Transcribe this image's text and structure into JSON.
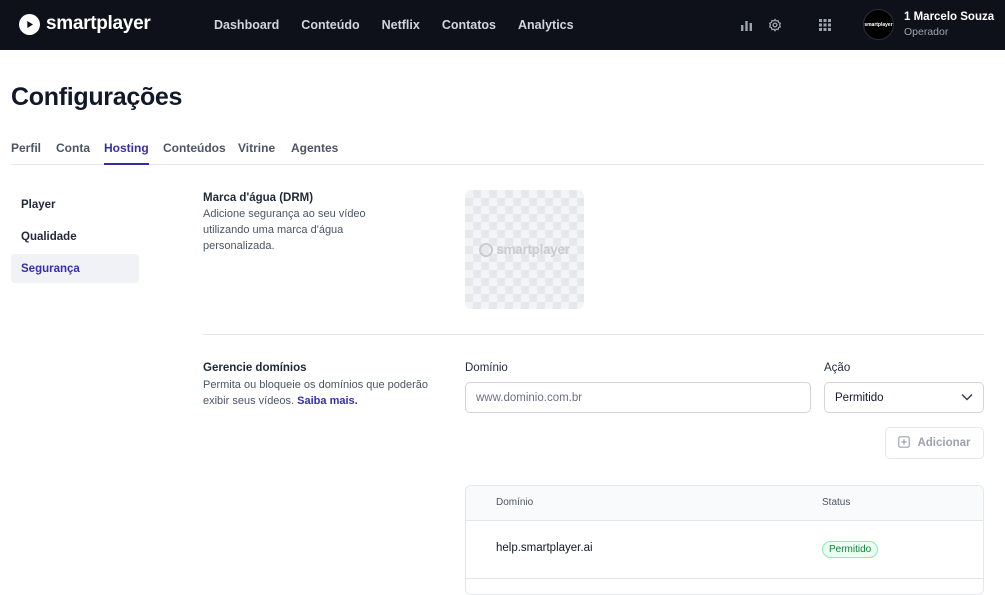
{
  "app": {
    "logo_text": "smartplayer",
    "nav": [
      "Dashboard",
      "Conteúdo",
      "Netflix",
      "Contatos",
      "Analytics"
    ],
    "avatar_text": "smartplayer",
    "user_name": "1 Marcelo Souza",
    "user_role": "Operador"
  },
  "page": {
    "title": "Configurações",
    "tabs": [
      "Perfil",
      "Conta",
      "Hosting",
      "Conteúdos",
      "Vitrine",
      "Agentes"
    ],
    "active_tab": "Hosting"
  },
  "sidebar": {
    "items": [
      "Player",
      "Qualidade",
      "Segurança"
    ],
    "active": "Segurança"
  },
  "watermark": {
    "title": "Marca d'água (DRM)",
    "description": "Adicione segurança ao seu vídeo utilizando uma marca d'água personalizada.",
    "preview_text": "smartplayer"
  },
  "domains": {
    "title": "Gerencie domínios",
    "description": "Permita ou bloqueie os domínios que poderão exibir seus vídeos.",
    "learn_more": "Saiba mais.",
    "domain_label": "Domínio",
    "domain_placeholder": "www.dominio.com.br",
    "action_label": "Ação",
    "action_value": "Permitido",
    "add_button": "Adicionar",
    "table": {
      "headers": [
        "Domínio",
        "Status"
      ],
      "rows": [
        {
          "domain": "help.smartplayer.ai",
          "status": "Permitido"
        }
      ]
    }
  },
  "colors": {
    "topbar": "#0f111a",
    "accent": "#3730a3",
    "status_green": "#15803d"
  },
  "icons": [
    "logo-play-icon",
    "bar-chart-icon",
    "gear-icon",
    "grid-icon",
    "chevron-down-icon",
    "plus-square-icon"
  ]
}
